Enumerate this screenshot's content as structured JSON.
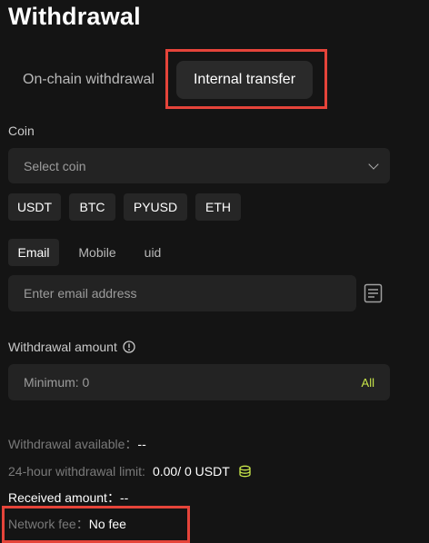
{
  "title": "Withdrawal",
  "tabs": {
    "onchain": "On-chain withdrawal",
    "internal": "Internal transfer"
  },
  "coin": {
    "label": "Coin",
    "placeholder": "Select coin",
    "quick": [
      "USDT",
      "BTC",
      "PYUSD",
      "ETH"
    ]
  },
  "method": {
    "tabs": [
      "Email",
      "Mobile",
      "uid"
    ],
    "selected": "Email",
    "placeholder": "Enter email address"
  },
  "amount": {
    "label": "Withdrawal amount",
    "placeholder": "Minimum: 0",
    "all_label": "All"
  },
  "summary": {
    "available_label": "Withdrawal available：",
    "available_value": "--",
    "limit_label": "24-hour withdrawal limit:",
    "limit_value": "0.00/ 0 USDT",
    "received_label": "Received amount：",
    "received_value": "--",
    "fee_label": "Network fee：",
    "fee_value": "No fee"
  },
  "colors": {
    "background": "#141414",
    "field": "#232323",
    "accent": "#c8e64a",
    "highlight": "#e5443a"
  },
  "icons": [
    "chevron-down-icon",
    "address-book-icon",
    "info-icon",
    "coin-stack-icon"
  ]
}
